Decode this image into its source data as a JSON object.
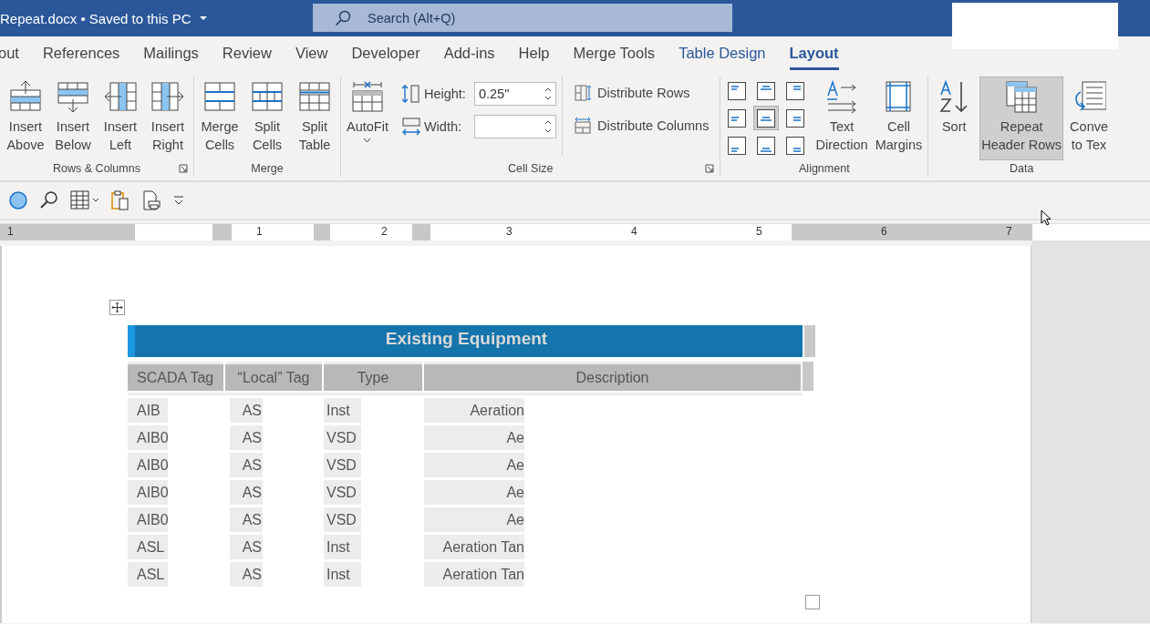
{
  "title_bar": {
    "document": "Repeat.docx • Saved to this PC",
    "search": {
      "placeholder": "Search (Alt+Q)"
    }
  },
  "tabs": [
    {
      "label": "out",
      "selected": false,
      "contextual": false
    },
    {
      "label": "References",
      "selected": false,
      "contextual": false
    },
    {
      "label": "Mailings",
      "selected": false,
      "contextual": false
    },
    {
      "label": "Review",
      "selected": false,
      "contextual": false
    },
    {
      "label": "View",
      "selected": false,
      "contextual": false
    },
    {
      "label": "Developer",
      "selected": false,
      "contextual": false
    },
    {
      "label": "Add-ins",
      "selected": false,
      "contextual": false
    },
    {
      "label": "Help",
      "selected": false,
      "contextual": false
    },
    {
      "label": "Merge Tools",
      "selected": false,
      "contextual": false
    },
    {
      "label": "Table Design",
      "selected": false,
      "contextual": true
    },
    {
      "label": "Layout",
      "selected": true,
      "contextual": true
    }
  ],
  "ribbon": [
    {
      "name": "Rows & Columns",
      "launcher": true,
      "parts": [
        {
          "kind": "insert-above",
          "lines": [
            "Insert",
            "Above"
          ],
          "pressed": false
        },
        {
          "kind": "insert-below",
          "lines": [
            "Insert",
            "Below"
          ],
          "pressed": false
        },
        {
          "kind": "insert-left",
          "lines": [
            "Insert",
            "Left"
          ],
          "pressed": false
        },
        {
          "kind": "insert-right",
          "lines": [
            "Insert",
            "Right"
          ],
          "pressed": false
        }
      ]
    },
    {
      "name": "Merge",
      "launcher": false,
      "parts": [
        {
          "kind": "merge",
          "lines": [
            "Merge",
            "Cells"
          ],
          "pressed": false
        },
        {
          "kind": "split-cells",
          "lines": [
            "Split",
            "Cells"
          ],
          "pressed": false
        },
        {
          "kind": "split-table",
          "lines": [
            "Split",
            "Table"
          ],
          "pressed": false
        }
      ]
    },
    {
      "name": "Cell Size",
      "launcher": true,
      "parts": [
        {
          "kind": "autofit",
          "lines": [
            "AutoFit"
          ],
          "pressed": false,
          "dropdown": true
        },
        {
          "kind": "fields",
          "fields": [
            {
              "label": "Height:",
              "value": "0.25\""
            },
            {
              "label": "Width:"
            }
          ]
        },
        {
          "kind": "distribute",
          "buttons": [
            {
              "label": "Distribute Rows"
            },
            {
              "label": "Distribute Columns"
            }
          ]
        }
      ]
    },
    {
      "name": "Alignment",
      "launcher": false,
      "parts": [
        {
          "kind": "align-grid",
          "cells": [
            {
              "selected": false
            },
            {
              "selected": false
            },
            {
              "selected": false
            },
            {
              "selected": false
            },
            {
              "selected": true
            },
            {
              "selected": false
            },
            {
              "selected": false
            },
            {
              "selected": false
            },
            {
              "selected": false
            }
          ]
        },
        {
          "kind": "text-direction",
          "lines": [
            "Text",
            "Direction"
          ],
          "pressed": false
        },
        {
          "kind": "cell-margins",
          "lines": [
            "Cell",
            "Margins"
          ],
          "pressed": false
        }
      ]
    },
    {
      "name": "Data",
      "launcher": false,
      "parts": [
        {
          "kind": "sort",
          "lines": [
            "Sort"
          ],
          "pressed": false
        },
        {
          "kind": "repeat-header",
          "lines": [
            "Repeat",
            "Header Rows"
          ],
          "pressed": true
        },
        {
          "kind": "convert",
          "lines": [
            "Conve",
            "to Tex"
          ],
          "pressed": false
        }
      ]
    }
  ],
  "ruler": [
    "1",
    "1",
    "2",
    "3",
    "4",
    "5",
    "6",
    "7"
  ],
  "table": {
    "title": "Existing Equipment",
    "columns": [
      "SCADA Tag",
      "“Local” Tag",
      "Type",
      "Description"
    ],
    "rows": [
      [
        "AIB",
        "AS",
        "Inst",
        "Aeration"
      ],
      [
        "AIB0",
        "AS",
        "VSD",
        "Ae"
      ],
      [
        "AIB0",
        "AS",
        "VSD",
        "Ae"
      ],
      [
        "AIB0",
        "AS",
        "VSD",
        "Ae"
      ],
      [
        "AIB0",
        "AS",
        "VSD",
        "Ae"
      ],
      [
        "ASL",
        "AS",
        "Inst",
        "Aeration Tan"
      ],
      [
        "ASL",
        "AS",
        "Inst",
        "Aeration Tan"
      ]
    ]
  }
}
